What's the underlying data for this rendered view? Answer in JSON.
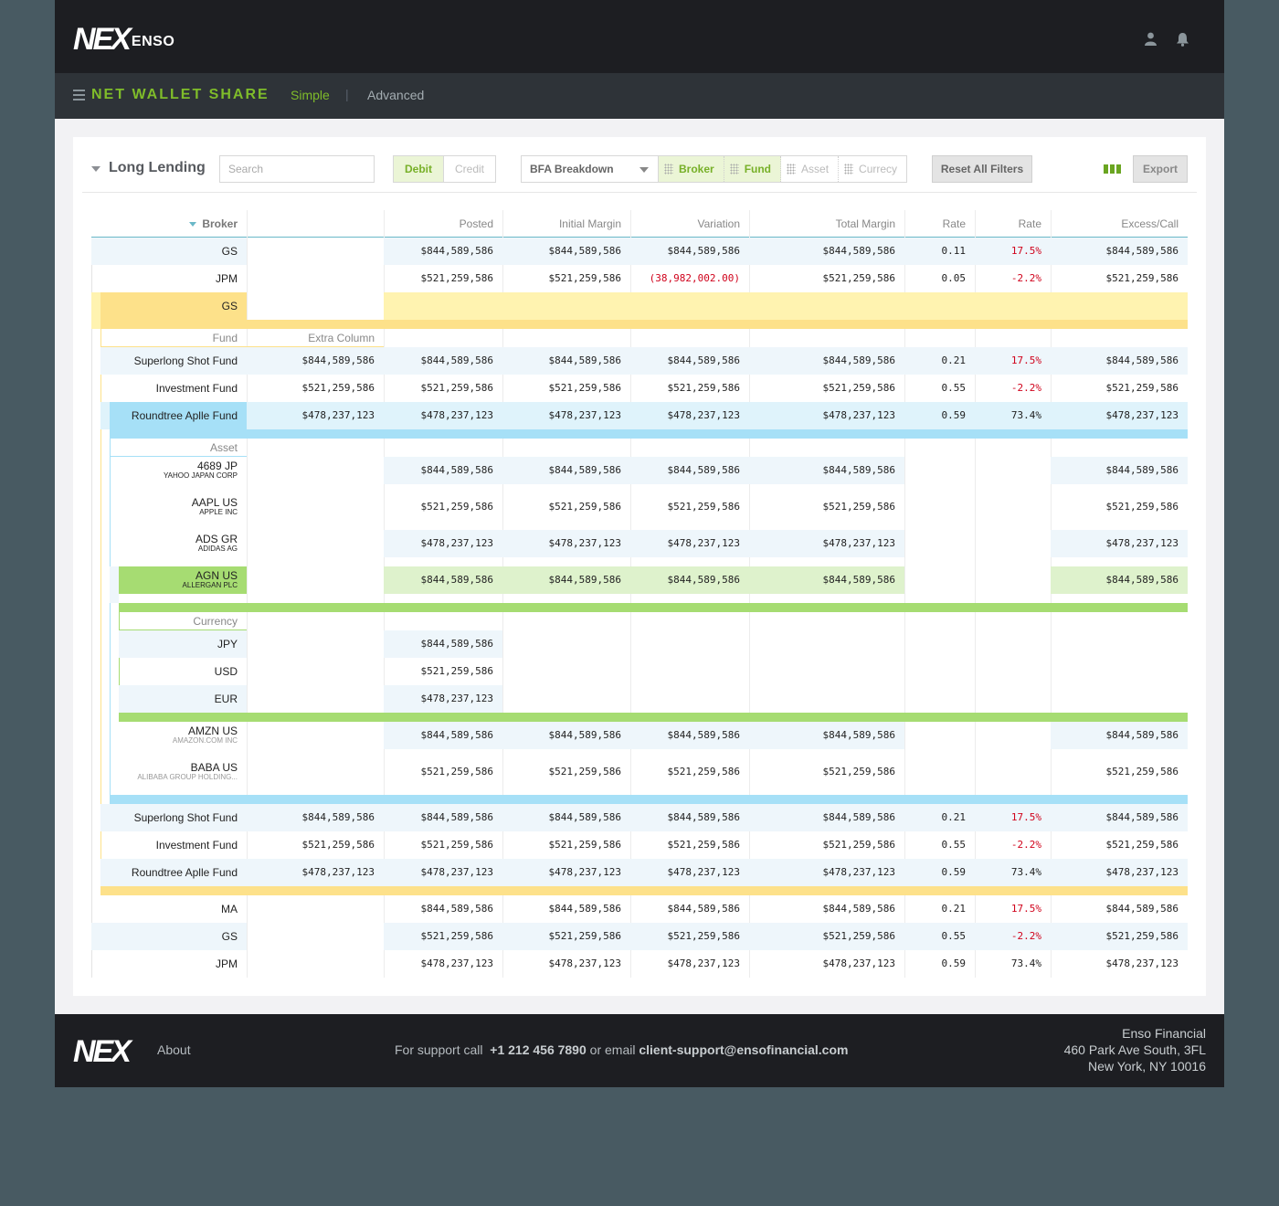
{
  "brand": {
    "logo": "NEX",
    "sub": "ENSO",
    "footer_logo": "NEX"
  },
  "nav": {
    "title": "NET WALLET SHARE",
    "tab_simple": "Simple",
    "separator": "|",
    "tab_advanced": "Advanced"
  },
  "toolbar": {
    "title": "Long Lending",
    "search_placeholder": "Search",
    "debit": "Debit",
    "credit": "Credit",
    "bfa": "BFA Breakdown",
    "chips": [
      "Broker",
      "Fund",
      "Asset",
      "Currecy"
    ],
    "reset": "Reset All Filters",
    "export": "Export"
  },
  "colors": {
    "accent": "#7fbc2a",
    "negative": "#d0021b",
    "broker_highlight": "#fde18a",
    "fund_highlight": "#a6e0f7",
    "asset_highlight": "#a6dc72"
  },
  "columns": {
    "broker": "Broker",
    "posted": "Posted",
    "initial_margin": "Initial Margin",
    "variation": "Variation",
    "total_margin": "Total Margin",
    "rate1": "Rate",
    "rate2": "Rate",
    "excess": "Excess/Call",
    "fund": "Fund",
    "extra": "Extra Column",
    "asset": "Asset",
    "currency": "Currency"
  },
  "rows": {
    "r1": {
      "name": "GS",
      "posted": "$844,589,586",
      "im": "$844,589,586",
      "var": "$844,589,586",
      "tm": "$844,589,586",
      "rate": "0.11",
      "pct": "17.5%",
      "ex": "$844,589,586"
    },
    "r2": {
      "name": "JPM",
      "posted": "$521,259,586",
      "im": "$521,259,586",
      "var": "(38,982,002.00)",
      "tm": "$521,259,586",
      "rate": "0.05",
      "pct": "-2.2%",
      "ex": "$521,259,586"
    },
    "r3": {
      "name": "GS"
    },
    "f1": {
      "name": "Superlong Shot Fund",
      "extra": "$844,589,586",
      "posted": "$844,589,586",
      "im": "$844,589,586",
      "var": "$844,589,586",
      "tm": "$844,589,586",
      "rate": "0.21",
      "pct": "17.5%",
      "ex": "$844,589,586"
    },
    "f2": {
      "name": "Investment Fund",
      "extra": "$521,259,586",
      "posted": "$521,259,586",
      "im": "$521,259,586",
      "var": "$521,259,586",
      "tm": "$521,259,586",
      "rate": "0.55",
      "pct": "-2.2%",
      "ex": "$521,259,586"
    },
    "f3": {
      "name": "Roundtree Aplle Fund",
      "extra": "$478,237,123",
      "posted": "$478,237,123",
      "im": "$478,237,123",
      "var": "$478,237,123",
      "tm": "$478,237,123",
      "rate": "0.59",
      "pct": "73.4%",
      "ex": "$478,237,123"
    },
    "a1": {
      "name": "4689 JP",
      "sub": "YAHOO JAPAN CORP",
      "posted": "$844,589,586",
      "im": "$844,589,586",
      "var": "$844,589,586",
      "tm": "$844,589,586",
      "ex": "$844,589,586"
    },
    "a2": {
      "name": "AAPL US",
      "sub": "APPLE INC",
      "posted": "$521,259,586",
      "im": "$521,259,586",
      "var": "$521,259,586",
      "tm": "$521,259,586",
      "ex": "$521,259,586"
    },
    "a3": {
      "name": "ADS GR",
      "sub": "ADIDAS AG",
      "posted": "$478,237,123",
      "im": "$478,237,123",
      "var": "$478,237,123",
      "tm": "$478,237,123",
      "ex": "$478,237,123"
    },
    "a4": {
      "name": "AGN US",
      "sub": "ALLERGAN PLC",
      "posted": "$844,589,586",
      "im": "$844,589,586",
      "var": "$844,589,586",
      "tm": "$844,589,586",
      "ex": "$844,589,586"
    },
    "c1": {
      "name": "JPY",
      "posted": "$844,589,586"
    },
    "c2": {
      "name": "USD",
      "posted": "$521,259,586"
    },
    "c3": {
      "name": "EUR",
      "posted": "$478,237,123"
    },
    "a5": {
      "name": "AMZN US",
      "sub": "AMAZON.COM INC",
      "posted": "$844,589,586",
      "im": "$844,589,586",
      "var": "$844,589,586",
      "tm": "$844,589,586",
      "ex": "$844,589,586"
    },
    "a6": {
      "name": "BABA US",
      "sub": "ALIBABA GROUP HOLDING...",
      "posted": "$521,259,586",
      "im": "$521,259,586",
      "var": "$521,259,586",
      "tm": "$521,259,586",
      "ex": "$521,259,586"
    },
    "f4": {
      "name": "Superlong Shot Fund",
      "extra": "$844,589,586",
      "posted": "$844,589,586",
      "im": "$844,589,586",
      "var": "$844,589,586",
      "tm": "$844,589,586",
      "rate": "0.21",
      "pct": "17.5%",
      "ex": "$844,589,586"
    },
    "f5": {
      "name": "Investment Fund",
      "extra": "$521,259,586",
      "posted": "$521,259,586",
      "im": "$521,259,586",
      "var": "$521,259,586",
      "tm": "$521,259,586",
      "rate": "0.55",
      "pct": "-2.2%",
      "ex": "$521,259,586"
    },
    "f6": {
      "name": "Roundtree Aplle Fund",
      "extra": "$478,237,123",
      "posted": "$478,237,123",
      "im": "$478,237,123",
      "var": "$478,237,123",
      "tm": "$478,237,123",
      "rate": "0.59",
      "pct": "73.4%",
      "ex": "$478,237,123"
    },
    "b1": {
      "name": "MA",
      "posted": "$844,589,586",
      "im": "$844,589,586",
      "var": "$844,589,586",
      "tm": "$844,589,586",
      "rate": "0.21",
      "pct": "17.5%",
      "ex": "$844,589,586"
    },
    "b2": {
      "name": "GS",
      "posted": "$521,259,586",
      "im": "$521,259,586",
      "var": "$521,259,586",
      "tm": "$521,259,586",
      "rate": "0.55",
      "pct": "-2.2%",
      "ex": "$521,259,586"
    },
    "b3": {
      "name": "JPM",
      "posted": "$478,237,123",
      "im": "$478,237,123",
      "var": "$478,237,123",
      "tm": "$478,237,123",
      "rate": "0.59",
      "pct": "73.4%",
      "ex": "$478,237,123"
    }
  },
  "footer": {
    "about": "About",
    "support_pre": "For support call",
    "phone": "+1 212 456 7890",
    "or_email": "or email",
    "email": "client-support@ensofinancial.com",
    "company": "Enso Financial",
    "addr1": "460 Park Ave South, 3FL",
    "addr2": "New York, NY 10016"
  }
}
